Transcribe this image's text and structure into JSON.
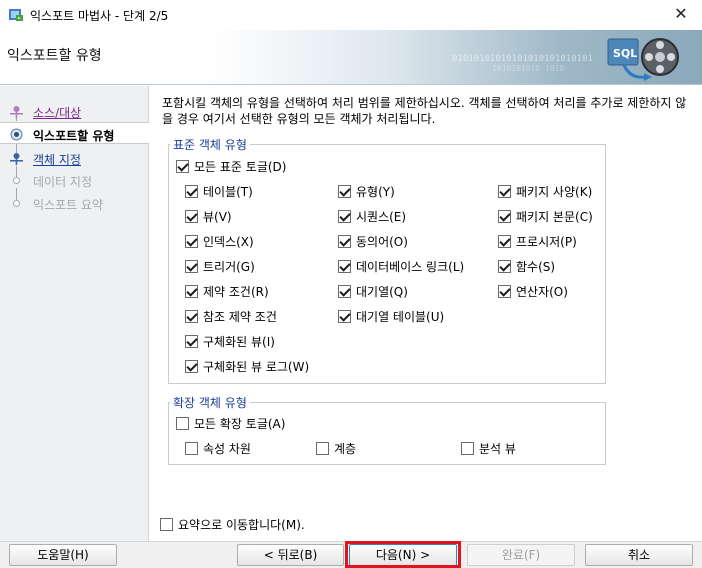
{
  "window": {
    "title": "익스포트 마법사 - 단계 2/5",
    "close_glyph": "✕"
  },
  "header": {
    "title": "익스포트할 유형",
    "binary_line1": "01010101010101010101010101",
    "binary_line2": "1010101010 1010"
  },
  "steps": [
    {
      "label": "소스/대상",
      "state": "visited"
    },
    {
      "label": "익스포트할 유형",
      "state": "current"
    },
    {
      "label": "객체 지정",
      "state": "link"
    },
    {
      "label": "데이터 지정",
      "state": "disabled"
    },
    {
      "label": "익스포트 요약",
      "state": "disabled"
    }
  ],
  "description": "포함시킬 객체의 유형을 선택하여 처리 범위를 제한하십시오. 객체를 선택하여 처리를 추가로 제한하지 않을 경우 여기서 선택한 유형의 모든 객체가 처리됩니다.",
  "standard_group": {
    "title": "표준 객체 유형",
    "toggle_all": {
      "label": "모든 표준 토글(D)",
      "checked": true
    },
    "col1": [
      {
        "label": "테이블(T)",
        "checked": true
      },
      {
        "label": "뷰(V)",
        "checked": true
      },
      {
        "label": "인덱스(X)",
        "checked": true
      },
      {
        "label": "트리거(G)",
        "checked": true
      },
      {
        "label": "제약 조건(R)",
        "checked": true
      },
      {
        "label": "참조 제약 조건",
        "checked": true
      },
      {
        "label": "구체화된 뷰(I)",
        "checked": true
      },
      {
        "label": "구체화된 뷰 로그(W)",
        "checked": true
      }
    ],
    "col2": [
      {
        "label": "유형(Y)",
        "checked": true
      },
      {
        "label": "시퀀스(E)",
        "checked": true
      },
      {
        "label": "동의어(O)",
        "checked": true
      },
      {
        "label": "데이터베이스 링크(L)",
        "checked": true
      },
      {
        "label": "대기열(Q)",
        "checked": true
      },
      {
        "label": "대기열 테이블(U)",
        "checked": true
      }
    ],
    "col3": [
      {
        "label": "패키지 사양(K)",
        "checked": true
      },
      {
        "label": "패키지 본문(C)",
        "checked": true
      },
      {
        "label": "프로시저(P)",
        "checked": true
      },
      {
        "label": "함수(S)",
        "checked": true
      },
      {
        "label": "연산자(O)",
        "checked": true
      }
    ]
  },
  "extended_group": {
    "title": "확장 객체 유형",
    "toggle_all": {
      "label": "모든 확장 토글(A)",
      "checked": false
    },
    "items": [
      {
        "label": "속성 차원",
        "checked": false
      },
      {
        "label": "계층",
        "checked": false
      },
      {
        "label": "분석 뷰",
        "checked": false
      }
    ]
  },
  "summary_checkbox": {
    "label": "요약으로 이동합니다(M).",
    "checked": false
  },
  "buttons": {
    "help": "도움말(H)",
    "back": "< 뒤로(B)",
    "next": "다음(N) >",
    "finish": "완료(F)",
    "cancel": "취소"
  },
  "colors": {
    "accent_link": "#1d3f9a",
    "visited_link": "#7a2a8c",
    "highlight": "#e0141e"
  }
}
